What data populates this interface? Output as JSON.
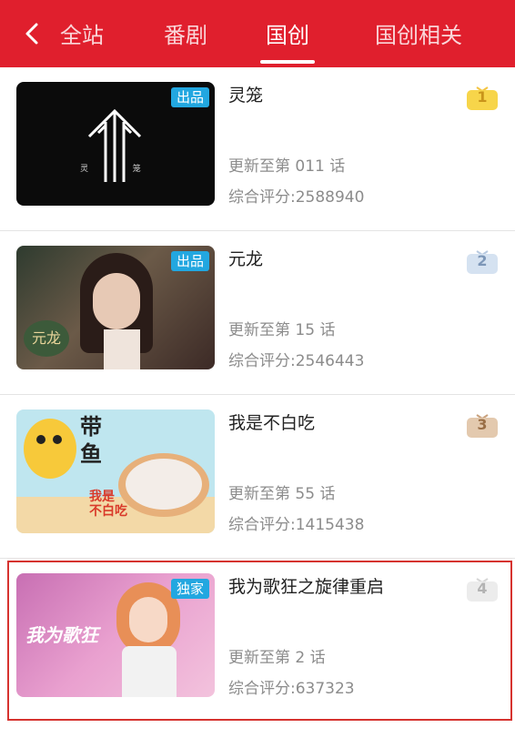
{
  "nav": {
    "back_icon": "chevron-left-icon",
    "tabs": [
      {
        "label": "全站",
        "active": false
      },
      {
        "label": "番剧",
        "active": false
      },
      {
        "label": "国创",
        "active": true
      },
      {
        "label": "国创相关",
        "active": false
      }
    ]
  },
  "items": [
    {
      "badge": "出品",
      "title": "灵笼",
      "update": "更新至第 011 话",
      "score": "综合评分:2588940",
      "rank": "1",
      "rank_color": "#f4c542",
      "thumb_text": "灵                 笼"
    },
    {
      "badge": "出品",
      "title": "元龙",
      "update": "更新至第 15 话",
      "score": "综合评分:2546443",
      "rank": "2",
      "rank_color": "#9fb8d6",
      "thumb_text": "元龙"
    },
    {
      "badge": "",
      "title": "我是不白吃",
      "update": "更新至第 55 话",
      "score": "综合评分:1415438",
      "rank": "3",
      "rank_color": "#c9a27e",
      "thumb_text": "带\n鱼",
      "thumb_sub": "我是\n不白吃"
    },
    {
      "badge": "独家",
      "title": "我为歌狂之旋律重启",
      "update": "更新至第 2 话",
      "score": "综合评分:637323",
      "rank": "4",
      "rank_color": "#d6d6d6",
      "thumb_text": "我为歌狂"
    }
  ]
}
